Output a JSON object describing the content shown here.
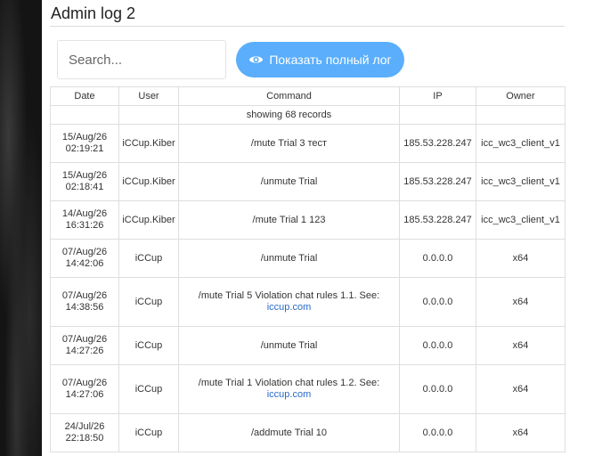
{
  "page": {
    "title": "Admin log 2"
  },
  "search": {
    "placeholder": "Search...",
    "value": ""
  },
  "full_log_button": {
    "label": "Показать полный лог",
    "icon": "eye-icon"
  },
  "table": {
    "headers": {
      "date": "Date",
      "user": "User",
      "command": "Command",
      "ip": "IP",
      "owner": "Owner"
    },
    "records_info": "showing 68 records",
    "rows": [
      {
        "date": "15/Aug/26",
        "time": "02:19:21",
        "user": "iCCup.Kiber",
        "command": "/mute Trial 3 тест",
        "link": "",
        "ip": "185.53.228.247",
        "owner": "icc_wc3_client_v1"
      },
      {
        "date": "15/Aug/26",
        "time": "02:18:41",
        "user": "iCCup.Kiber",
        "command": "/unmute Trial",
        "link": "",
        "ip": "185.53.228.247",
        "owner": "icc_wc3_client_v1"
      },
      {
        "date": "14/Aug/26",
        "time": "16:31:26",
        "user": "iCCup.Kiber",
        "command": "/mute Trial 1 123",
        "link": "",
        "ip": "185.53.228.247",
        "owner": "icc_wc3_client_v1"
      },
      {
        "date": "07/Aug/26",
        "time": "14:42:06",
        "user": "iCCup",
        "command": "/unmute Trial",
        "link": "",
        "ip": "0.0.0.0",
        "owner": "x64"
      },
      {
        "date": "07/Aug/26",
        "time": "14:38:56",
        "user": "iCCup",
        "command": "/mute Trial 5 Violation chat rules 1.1. See:",
        "link": "iccup.com",
        "ip": "0.0.0.0",
        "owner": "x64"
      },
      {
        "date": "07/Aug/26",
        "time": "14:27:26",
        "user": "iCCup",
        "command": "/unmute Trial",
        "link": "",
        "ip": "0.0.0.0",
        "owner": "x64"
      },
      {
        "date": "07/Aug/26",
        "time": "14:27:06",
        "user": "iCCup",
        "command": "/mute Trial 1 Violation chat rules 1.2. See:",
        "link": "iccup.com",
        "ip": "0.0.0.0",
        "owner": "x64"
      },
      {
        "date": "24/Jul/26",
        "time": "22:18:50",
        "user": "iCCup",
        "command": "/addmute Trial 10",
        "link": "",
        "ip": "0.0.0.0",
        "owner": "x64"
      }
    ]
  }
}
